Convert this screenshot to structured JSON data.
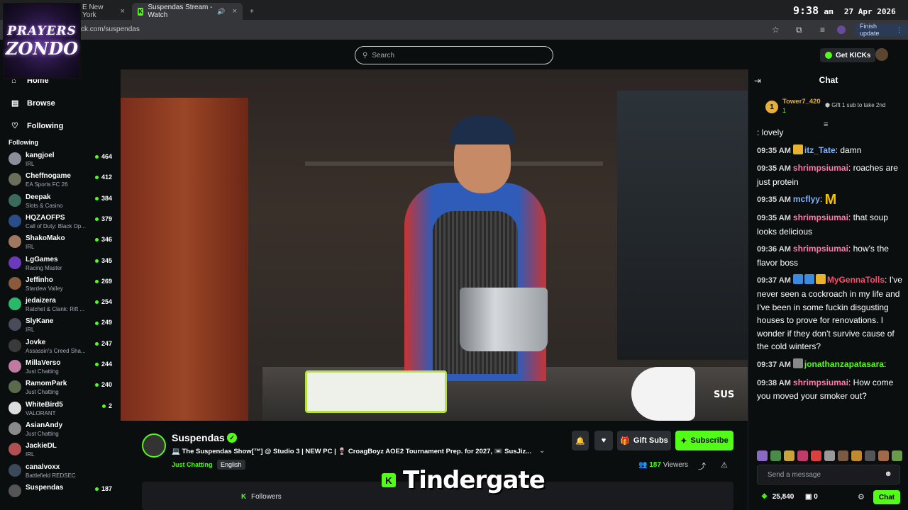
{
  "browser": {
    "tabs": [
      {
        "label": "E New York",
        "close": "×"
      },
      {
        "label": "Suspendas Stream - Watch",
        "close": "×"
      }
    ],
    "new_tab": "+",
    "url": "ck.com/suspendas",
    "finish_update": "Finish update",
    "clock": {
      "time": "9:38",
      "ampm": "am",
      "date": "27 Apr 2026"
    }
  },
  "logo": {
    "line1": "PRAYERS",
    "line2": "ZONDO"
  },
  "header": {
    "search_placeholder": "Search",
    "get_kicks": "Get KICKs"
  },
  "sidebar": {
    "nav": [
      {
        "label": "Home",
        "icon": "home-icon"
      },
      {
        "label": "Browse",
        "icon": "browse-icon"
      },
      {
        "label": "Following",
        "icon": "heart-icon"
      }
    ],
    "following_heading": "Following",
    "following": [
      {
        "name": "kangjoel",
        "category": "IRL",
        "viewers": "464",
        "color": "#8a8f99"
      },
      {
        "name": "Cheffnogame",
        "category": "EA Sports FC 26",
        "viewers": "412",
        "color": "#6b6e5a"
      },
      {
        "name": "Deepak",
        "category": "Slots & Casino",
        "viewers": "384",
        "color": "#3a6a5a"
      },
      {
        "name": "HQZAOFPS",
        "category": "Call of Duty: Black Op...",
        "viewers": "379",
        "color": "#2a4d8a"
      },
      {
        "name": "ShakoMako",
        "category": "IRL",
        "viewers": "346",
        "color": "#a07860"
      },
      {
        "name": "LgGames",
        "category": "Racing Master",
        "viewers": "345",
        "color": "#6a3ab8"
      },
      {
        "name": "Jeffinho",
        "category": "Stardew Valley",
        "viewers": "269",
        "color": "#8a5a3a"
      },
      {
        "name": "jedaizera",
        "category": "Ratchet & Clank: Rift ...",
        "viewers": "254",
        "color": "#2ab86a"
      },
      {
        "name": "SlyKane",
        "category": "IRL",
        "viewers": "249",
        "color": "#4a4a5a"
      },
      {
        "name": "Jovke",
        "category": "Assassin's Creed Sha...",
        "viewers": "247",
        "color": "#3a3a3a"
      },
      {
        "name": "MillaVerso",
        "category": "Just Chatting",
        "viewers": "244",
        "color": "#c07aa0"
      },
      {
        "name": "RamomPark",
        "category": "Just Chatting",
        "viewers": "240",
        "color": "#5a6a4a"
      },
      {
        "name": "WhiteBird5",
        "category": "VALORANT",
        "viewers": "2",
        "color": "#dddddd"
      },
      {
        "name": "AsianAndy",
        "category": "Just Chatting",
        "viewers": "",
        "color": "#8a8a8a"
      },
      {
        "name": "JackieDL",
        "category": "IRL",
        "viewers": "",
        "color": "#b05050"
      },
      {
        "name": "canalvoxx",
        "category": "Battlefield REDSEC",
        "viewers": "",
        "color": "#3a4a5a"
      },
      {
        "name": "Suspendas",
        "category": "",
        "viewers": "187",
        "color": "#555555"
      }
    ]
  },
  "stream": {
    "streamer": "Suspendas",
    "title": "💻 The Suspendas Show[™] @ Studio 3 | NEW PC | 🍷 CroagBoyz AOE2 Tournament Prep. for 2027, 📼 SusJiz...",
    "category": "Just Chatting",
    "language": "English",
    "gift_subs": "Gift Subs",
    "subscribe": "Subscribe",
    "viewers": "187",
    "viewers_label": "Viewers",
    "followers_label": "Followers",
    "followers_prefix": "K",
    "watermark": "SUS",
    "caption": "Tindergate",
    "caption_badge": "K"
  },
  "chat": {
    "title": "Chat",
    "pinned": {
      "rank": "1",
      "user": "Tower7_420",
      "count": "1",
      "message": "Gift 1 sub to take 2nd"
    },
    "messages": [
      {
        "time": "",
        "user": "",
        "text": ": lovely",
        "color": "#ffffff"
      },
      {
        "time": "09:35 AM",
        "user": "itz_Tate",
        "text": ": damn",
        "color": "#7fb3ff",
        "badges": [
          "#e8b32a"
        ]
      },
      {
        "time": "09:35 AM",
        "user": "shrimpsiumai",
        "text": ": roaches are just protein",
        "color": "#ff7aa8"
      },
      {
        "time": "09:35 AM",
        "user": "mcflyy",
        "text": ": ",
        "color": "#7fb3ff",
        "emote": "M"
      },
      {
        "time": "09:35 AM",
        "user": "shrimpsiumai",
        "text": ": that soup looks delicious",
        "color": "#ff7aa8"
      },
      {
        "time": "09:36 AM",
        "user": "shrimpsiumai",
        "text": ": how's the flavor boss",
        "color": "#ff7aa8"
      },
      {
        "time": "09:37 AM",
        "user": "MyGennaTolls",
        "text": ": I've never seen a cockroach in my life and I've been in some fuckin disgusting houses to prove for renovations. I wonder if they don't survive cause of the cold winters?",
        "color": "#ff4d6d",
        "badges": [
          "#3a8ae0",
          "#3a8ae0",
          "#e8b32a"
        ]
      },
      {
        "time": "09:37 AM",
        "user": "jonathanzapatasara",
        "text": ":",
        "color": "#53fc18",
        "badges": [
          "#888888"
        ]
      },
      {
        "time": "09:38 AM",
        "user": "shrimpsiumai",
        "text": ": How come you moved your smoker out?",
        "color": "#ff7aa8"
      }
    ],
    "input_placeholder": "Send a message",
    "kicks_balance": "25,840",
    "gift_count": "0",
    "chat_button": "Chat"
  }
}
